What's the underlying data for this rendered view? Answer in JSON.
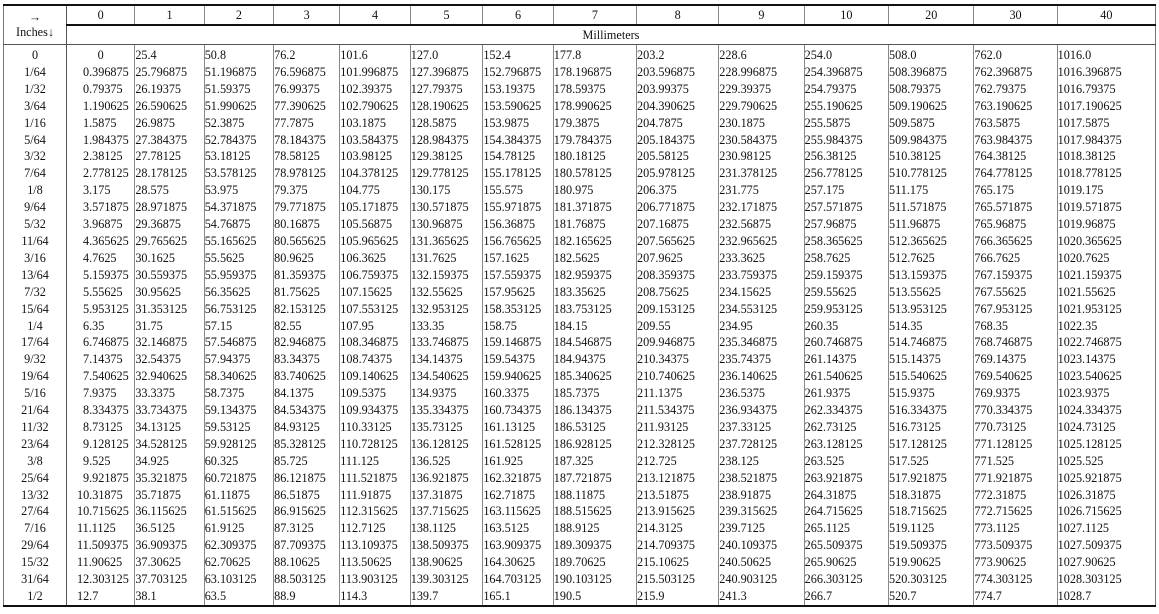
{
  "table": {
    "corner_top": "→",
    "corner_bottom": "Inches↓",
    "unit_label": "Millimeters",
    "columns": [
      "0",
      "1",
      "2",
      "3",
      "4",
      "5",
      "6",
      "7",
      "8",
      "9",
      "10",
      "20",
      "30",
      "40"
    ],
    "rows": [
      {
        "inch": "0",
        "mm": [
          "0",
          "25.4",
          "50.8",
          "76.2",
          "101.6",
          "127.0",
          "152.4",
          "177.8",
          "203.2",
          "228.6",
          "254.0",
          "508.0",
          "762.0",
          "1016.0"
        ]
      },
      {
        "inch": "1/64",
        "mm": [
          "0.396875",
          "25.796875",
          "51.196875",
          "76.596875",
          "101.996875",
          "127.396875",
          "152.796875",
          "178.196875",
          "203.596875",
          "228.996875",
          "254.396875",
          "508.396875",
          "762.396875",
          "1016.396875"
        ]
      },
      {
        "inch": "1/32",
        "mm": [
          "0.79375",
          "26.19375",
          "51.59375",
          "76.99375",
          "102.39375",
          "127.79375",
          "153.19375",
          "178.59375",
          "203.99375",
          "229.39375",
          "254.79375",
          "508.79375",
          "762.79375",
          "1016.79375"
        ]
      },
      {
        "inch": "3/64",
        "mm": [
          "1.190625",
          "26.590625",
          "51.990625",
          "77.390625",
          "102.790625",
          "128.190625",
          "153.590625",
          "178.990625",
          "204.390625",
          "229.790625",
          "255.190625",
          "509.190625",
          "763.190625",
          "1017.190625"
        ]
      },
      {
        "inch": "1/16",
        "mm": [
          "1.5875",
          "26.9875",
          "52.3875",
          "77.7875",
          "103.1875",
          "128.5875",
          "153.9875",
          "179.3875",
          "204.7875",
          "230.1875",
          "255.5875",
          "509.5875",
          "763.5875",
          "1017.5875"
        ]
      },
      {
        "inch": "5/64",
        "mm": [
          "1.984375",
          "27.384375",
          "52.784375",
          "78.184375",
          "103.584375",
          "128.984375",
          "154.384375",
          "179.784375",
          "205.184375",
          "230.584375",
          "255.984375",
          "509.984375",
          "763.984375",
          "1017.984375"
        ]
      },
      {
        "inch": "3/32",
        "mm": [
          "2.38125",
          "27.78125",
          "53.18125",
          "78.58125",
          "103.98125",
          "129.38125",
          "154.78125",
          "180.18125",
          "205.58125",
          "230.98125",
          "256.38125",
          "510.38125",
          "764.38125",
          "1018.38125"
        ]
      },
      {
        "inch": "7/64",
        "mm": [
          "2.778125",
          "28.178125",
          "53.578125",
          "78.978125",
          "104.378125",
          "129.778125",
          "155.178125",
          "180.578125",
          "205.978125",
          "231.378125",
          "256.778125",
          "510.778125",
          "764.778125",
          "1018.778125"
        ]
      },
      {
        "inch": "1/8",
        "mm": [
          "3.175",
          "28.575",
          "53.975",
          "79.375",
          "104.775",
          "130.175",
          "155.575",
          "180.975",
          "206.375",
          "231.775",
          "257.175",
          "511.175",
          "765.175",
          "1019.175"
        ]
      },
      {
        "inch": "9/64",
        "mm": [
          "3.571875",
          "28.971875",
          "54.371875",
          "79.771875",
          "105.171875",
          "130.571875",
          "155.971875",
          "181.371875",
          "206.771875",
          "232.171875",
          "257.571875",
          "511.571875",
          "765.571875",
          "1019.571875"
        ]
      },
      {
        "inch": "5/32",
        "mm": [
          "3.96875",
          "29.36875",
          "54.76875",
          "80.16875",
          "105.56875",
          "130.96875",
          "156.36875",
          "181.76875",
          "207.16875",
          "232.56875",
          "257.96875",
          "511.96875",
          "765.96875",
          "1019.96875"
        ]
      },
      {
        "inch": "11/64",
        "mm": [
          "4.365625",
          "29.765625",
          "55.165625",
          "80.565625",
          "105.965625",
          "131.365625",
          "156.765625",
          "182.165625",
          "207.565625",
          "232.965625",
          "258.365625",
          "512.365625",
          "766.365625",
          "1020.365625"
        ]
      },
      {
        "inch": "3/16",
        "mm": [
          "4.7625",
          "30.1625",
          "55.5625",
          "80.9625",
          "106.3625",
          "131.7625",
          "157.1625",
          "182.5625",
          "207.9625",
          "233.3625",
          "258.7625",
          "512.7625",
          "766.7625",
          "1020.7625"
        ]
      },
      {
        "inch": "13/64",
        "mm": [
          "5.159375",
          "30.559375",
          "55.959375",
          "81.359375",
          "106.759375",
          "132.159375",
          "157.559375",
          "182.959375",
          "208.359375",
          "233.759375",
          "259.159375",
          "513.159375",
          "767.159375",
          "1021.159375"
        ]
      },
      {
        "inch": "7/32",
        "mm": [
          "5.55625",
          "30.95625",
          "56.35625",
          "81.75625",
          "107.15625",
          "132.55625",
          "157.95625",
          "183.35625",
          "208.75625",
          "234.15625",
          "259.55625",
          "513.55625",
          "767.55625",
          "1021.55625"
        ]
      },
      {
        "inch": "15/64",
        "mm": [
          "5.953125",
          "31.353125",
          "56.753125",
          "82.153125",
          "107.553125",
          "132.953125",
          "158.353125",
          "183.753125",
          "209.153125",
          "234.553125",
          "259.953125",
          "513.953125",
          "767.953125",
          "1021.953125"
        ]
      },
      {
        "inch": "1/4",
        "mm": [
          "6.35",
          "31.75",
          "57.15",
          "82.55",
          "107.95",
          "133.35",
          "158.75",
          "184.15",
          "209.55",
          "234.95",
          "260.35",
          "514.35",
          "768.35",
          "1022.35"
        ]
      },
      {
        "inch": "17/64",
        "mm": [
          "6.746875",
          "32.146875",
          "57.546875",
          "82.946875",
          "108.346875",
          "133.746875",
          "159.146875",
          "184.546875",
          "209.946875",
          "235.346875",
          "260.746875",
          "514.746875",
          "768.746875",
          "1022.746875"
        ]
      },
      {
        "inch": "9/32",
        "mm": [
          "7.14375",
          "32.54375",
          "57.94375",
          "83.34375",
          "108.74375",
          "134.14375",
          "159.54375",
          "184.94375",
          "210.34375",
          "235.74375",
          "261.14375",
          "515.14375",
          "769.14375",
          "1023.14375"
        ]
      },
      {
        "inch": "19/64",
        "mm": [
          "7.540625",
          "32.940625",
          "58.340625",
          "83.740625",
          "109.140625",
          "134.540625",
          "159.940625",
          "185.340625",
          "210.740625",
          "236.140625",
          "261.540625",
          "515.540625",
          "769.540625",
          "1023.540625"
        ]
      },
      {
        "inch": "5/16",
        "mm": [
          "7.9375",
          "33.3375",
          "58.7375",
          "84.1375",
          "109.5375",
          "134.9375",
          "160.3375",
          "185.7375",
          "211.1375",
          "236.5375",
          "261.9375",
          "515.9375",
          "769.9375",
          "1023.9375"
        ]
      },
      {
        "inch": "21/64",
        "mm": [
          "8.334375",
          "33.734375",
          "59.134375",
          "84.534375",
          "109.934375",
          "135.334375",
          "160.734375",
          "186.134375",
          "211.534375",
          "236.934375",
          "262.334375",
          "516.334375",
          "770.334375",
          "1024.334375"
        ]
      },
      {
        "inch": "11/32",
        "mm": [
          "8.73125",
          "34.13125",
          "59.53125",
          "84.93125",
          "110.33125",
          "135.73125",
          "161.13125",
          "186.53125",
          "211.93125",
          "237.33125",
          "262.73125",
          "516.73125",
          "770.73125",
          "1024.73125"
        ]
      },
      {
        "inch": "23/64",
        "mm": [
          "9.128125",
          "34.528125",
          "59.928125",
          "85.328125",
          "110.728125",
          "136.128125",
          "161.528125",
          "186.928125",
          "212.328125",
          "237.728125",
          "263.128125",
          "517.128125",
          "771.128125",
          "1025.128125"
        ]
      },
      {
        "inch": "3/8",
        "mm": [
          "9.525",
          "34.925",
          "60.325",
          "85.725",
          "111.125",
          "136.525",
          "161.925",
          "187.325",
          "212.725",
          "238.125",
          "263.525",
          "517.525",
          "771.525",
          "1025.525"
        ]
      },
      {
        "inch": "25/64",
        "mm": [
          "9.921875",
          "35.321875",
          "60.721875",
          "86.121875",
          "111.521875",
          "136.921875",
          "162.321875",
          "187.721875",
          "213.121875",
          "238.521875",
          "263.921875",
          "517.921875",
          "771.921875",
          "1025.921875"
        ]
      },
      {
        "inch": "13/32",
        "mm": [
          "10.31875",
          "35.71875",
          "61.11875",
          "86.51875",
          "111.91875",
          "137.31875",
          "162.71875",
          "188.11875",
          "213.51875",
          "238.91875",
          "264.31875",
          "518.31875",
          "772.31875",
          "1026.31875"
        ]
      },
      {
        "inch": "27/64",
        "mm": [
          "10.715625",
          "36.115625",
          "61.515625",
          "86.915625",
          "112.315625",
          "137.715625",
          "163.115625",
          "188.515625",
          "213.915625",
          "239.315625",
          "264.715625",
          "518.715625",
          "772.715625",
          "1026.715625"
        ]
      },
      {
        "inch": "7/16",
        "mm": [
          "11.1125",
          "36.5125",
          "61.9125",
          "87.3125",
          "112.7125",
          "138.1125",
          "163.5125",
          "188.9125",
          "214.3125",
          "239.7125",
          "265.1125",
          "519.1125",
          "773.1125",
          "1027.1125"
        ]
      },
      {
        "inch": "29/64",
        "mm": [
          "11.509375",
          "36.909375",
          "62.309375",
          "87.709375",
          "113.109375",
          "138.509375",
          "163.909375",
          "189.309375",
          "214.709375",
          "240.109375",
          "265.509375",
          "519.509375",
          "773.509375",
          "1027.509375"
        ]
      },
      {
        "inch": "15/32",
        "mm": [
          "11.90625",
          "37.30625",
          "62.70625",
          "88.10625",
          "113.50625",
          "138.90625",
          "164.30625",
          "189.70625",
          "215.10625",
          "240.50625",
          "265.90625",
          "519.90625",
          "773.90625",
          "1027.90625"
        ]
      },
      {
        "inch": "31/64",
        "mm": [
          "12.303125",
          "37.703125",
          "63.103125",
          "88.503125",
          "113.903125",
          "139.303125",
          "164.703125",
          "190.103125",
          "215.503125",
          "240.903125",
          "266.303125",
          "520.303125",
          "774.303125",
          "1028.303125"
        ]
      },
      {
        "inch": "1/2",
        "mm": [
          "12.7",
          "38.1",
          "63.5",
          "88.9",
          "114.3",
          "139.7",
          "165.1",
          "190.5",
          "215.9",
          "241.3",
          "266.7",
          "520.7",
          "774.7",
          "1028.7"
        ]
      }
    ]
  }
}
